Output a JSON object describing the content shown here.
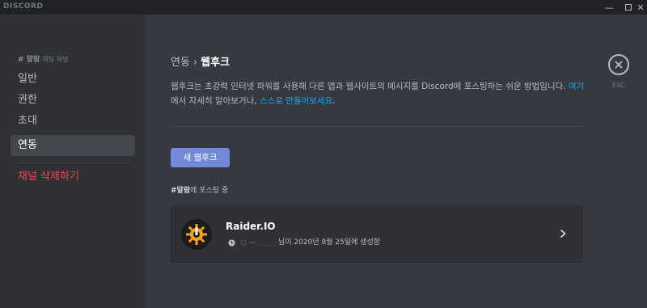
{
  "app": {
    "brand": "DISCORD"
  },
  "window": {
    "minimize": "—",
    "maximize": "",
    "close": "✕"
  },
  "sidebar": {
    "header_hash": "#",
    "header_channel": "알람",
    "header_sub": "채팅 채널",
    "items": [
      {
        "label": "일반"
      },
      {
        "label": "권한"
      },
      {
        "label": "초대"
      },
      {
        "label": "연동"
      }
    ],
    "delete_label": "채널 삭제하기"
  },
  "main": {
    "breadcrumb": {
      "parent": "연동",
      "separator": "›",
      "current": "웹후크"
    },
    "description": {
      "part1": "웹후크는 초강력 인터넷 파워를 사용해 다른 앱과 웹사이트의 메시지를 Discord에 포스팅하는 쉬운 방법입니다. ",
      "link1": "여기",
      "part2": "에서 자세히 알아보거나, ",
      "link2": "스스로 만들어보세요",
      "part3": "."
    },
    "new_webhook_button": "새 웹후크",
    "posting_channel": "#알람",
    "posting_suffix": "에 포스팅 중",
    "webhook": {
      "name": "Raider.IO",
      "created_text": "님이 2020년 8월 25일에 생성함"
    },
    "esc_label": "ESC"
  },
  "colors": {
    "accent": "#7289da",
    "link": "#00b0f4",
    "danger": "#f04747",
    "background": "#36393f",
    "sidebar": "#2f3136",
    "titlebar": "#202225"
  },
  "icons": {
    "window_minimize": "minimize-icon",
    "window_maximize": "maximize-icon",
    "window_close": "close-icon",
    "esc": "close-circle-icon",
    "clock": "clock-icon",
    "chevron": "chevron-right-icon",
    "avatar": "raiderio-logo-icon"
  }
}
